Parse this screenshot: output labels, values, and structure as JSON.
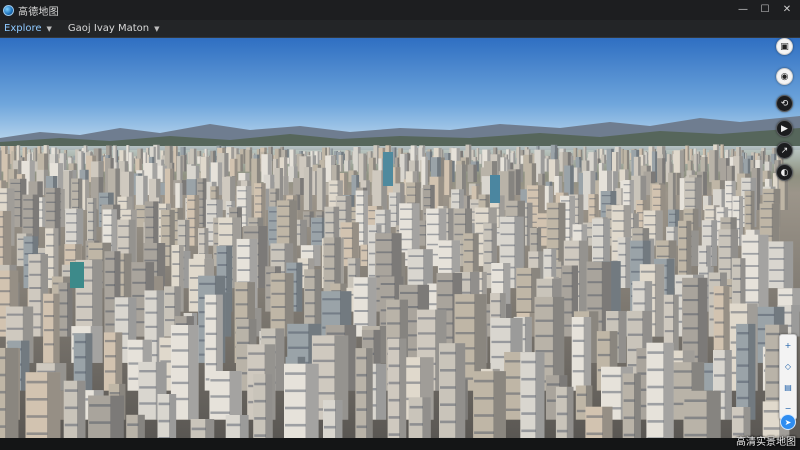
{
  "window": {
    "title": "高德地图",
    "controls": {
      "minimize": "—",
      "maximize": "☐",
      "close": "✕"
    }
  },
  "toolbar": {
    "explore_label": "Explore",
    "explore_caret": "▼",
    "view_label": "Gaoj Ivay Maton",
    "view_caret": "▼"
  },
  "viewport": {
    "description_icons": {
      "sky": "sky",
      "mountains": "mountain-range",
      "city": "city-buildings"
    },
    "colors": {
      "sky_top": "#3a7fd0",
      "sky_bottom": "#b9d7ef",
      "mountain": "#5d6a7c",
      "ground": "#8f8a7e"
    }
  },
  "side_controls": [
    {
      "name": "layers-icon",
      "glyph": "▣"
    },
    {
      "name": "location-icon",
      "glyph": "◉"
    },
    {
      "name": "rotate-icon",
      "glyph": "⟲"
    },
    {
      "name": "play-icon",
      "glyph": "▶"
    },
    {
      "name": "share-icon",
      "glyph": "↗"
    },
    {
      "name": "camera-icon",
      "glyph": "◐"
    }
  ],
  "mini_controls": [
    {
      "name": "zoom-in-icon",
      "glyph": "+"
    },
    {
      "name": "tilt-icon",
      "glyph": "◇"
    },
    {
      "name": "map-type-icon",
      "glyph": "▤"
    },
    {
      "name": "zoom-out-icon",
      "glyph": "−"
    }
  ],
  "compass_glyph": "➤",
  "watermark": "高清实景地图"
}
